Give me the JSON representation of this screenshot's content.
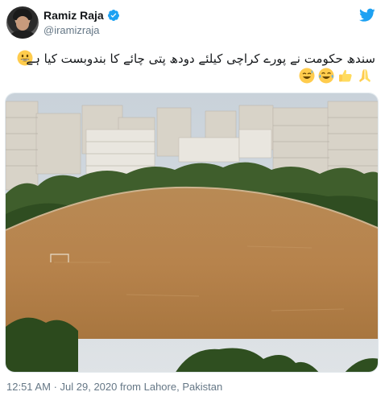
{
  "user": {
    "display_name": "Ramiz Raja",
    "handle": "@iramizraja",
    "verified": true
  },
  "tweet": {
    "text": "سندھ حکومت نے پورے کراچی کیلئے دودھ پتی چائے کا بندوبست کیا ہے",
    "emojis": [
      "grinning-face",
      "folded-hands",
      "thumbs-up",
      "tears-of-joy",
      "sweat-smile"
    ],
    "media": {
      "alt": "Flooded field surrounded by residential high-rise buildings"
    }
  },
  "meta": {
    "time": "12:51 AM",
    "separator": "·",
    "date": "Jul 29, 2020",
    "source": "from Lahore, Pakistan"
  },
  "colors": {
    "accent": "#1da1f2",
    "muted": "#657786",
    "text": "#14171a",
    "water": "#b8864e"
  },
  "icons": {
    "brand": "twitter-bird-icon",
    "verified": "verified-badge-icon"
  }
}
